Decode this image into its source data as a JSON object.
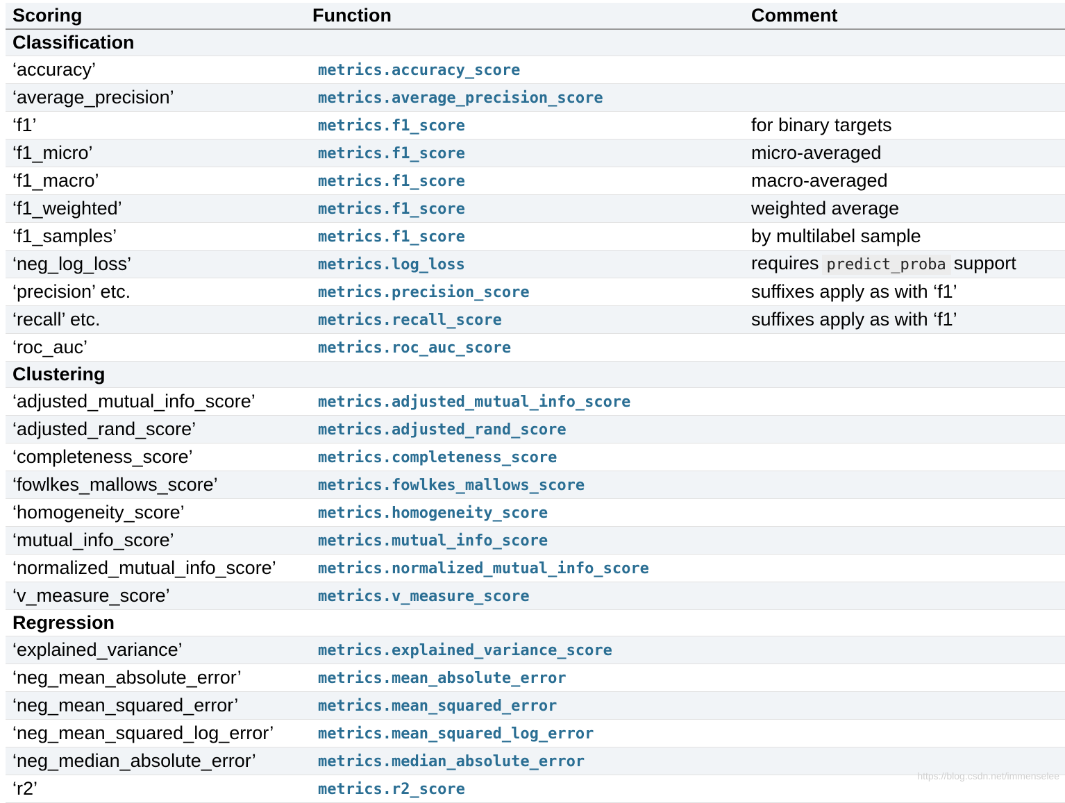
{
  "headers": {
    "scoring": "Scoring",
    "function": "Function",
    "comment": "Comment"
  },
  "sections": {
    "classification": "Classification",
    "clustering": "Clustering",
    "regression": "Regression"
  },
  "classification": [
    {
      "scoring": "‘accuracy’",
      "function": "metrics.accuracy_score",
      "comment": ""
    },
    {
      "scoring": "‘average_precision’",
      "function": "metrics.average_precision_score",
      "comment": ""
    },
    {
      "scoring": "‘f1’",
      "function": "metrics.f1_score",
      "comment": "for binary targets"
    },
    {
      "scoring": "‘f1_micro’",
      "function": "metrics.f1_score",
      "comment": "micro-averaged"
    },
    {
      "scoring": "‘f1_macro’",
      "function": "metrics.f1_score",
      "comment": "macro-averaged"
    },
    {
      "scoring": "‘f1_weighted’",
      "function": "metrics.f1_score",
      "comment": "weighted average"
    },
    {
      "scoring": "‘f1_samples’",
      "function": "metrics.f1_score",
      "comment": "by multilabel sample"
    },
    {
      "scoring": "‘neg_log_loss’",
      "function": "metrics.log_loss",
      "comment_before": "requires",
      "comment_code": "predict_proba",
      "comment_after": "support"
    },
    {
      "scoring": "‘precision’ etc.",
      "function": "metrics.precision_score",
      "comment": "suffixes apply as with ‘f1’"
    },
    {
      "scoring": "‘recall’ etc.",
      "function": "metrics.recall_score",
      "comment": "suffixes apply as with ‘f1’"
    },
    {
      "scoring": "‘roc_auc’",
      "function": "metrics.roc_auc_score",
      "comment": ""
    }
  ],
  "clustering": [
    {
      "scoring": "‘adjusted_mutual_info_score’",
      "function": "metrics.adjusted_mutual_info_score",
      "comment": ""
    },
    {
      "scoring": "‘adjusted_rand_score’",
      "function": "metrics.adjusted_rand_score",
      "comment": ""
    },
    {
      "scoring": "‘completeness_score’",
      "function": "metrics.completeness_score",
      "comment": ""
    },
    {
      "scoring": "‘fowlkes_mallows_score’",
      "function": "metrics.fowlkes_mallows_score",
      "comment": ""
    },
    {
      "scoring": "‘homogeneity_score’",
      "function": "metrics.homogeneity_score",
      "comment": ""
    },
    {
      "scoring": "‘mutual_info_score’",
      "function": "metrics.mutual_info_score",
      "comment": ""
    },
    {
      "scoring": "‘normalized_mutual_info_score’",
      "function": "metrics.normalized_mutual_info_score",
      "comment": ""
    },
    {
      "scoring": "‘v_measure_score’",
      "function": "metrics.v_measure_score",
      "comment": ""
    }
  ],
  "regression": [
    {
      "scoring": "‘explained_variance’",
      "function": "metrics.explained_variance_score",
      "comment": ""
    },
    {
      "scoring": "‘neg_mean_absolute_error’",
      "function": "metrics.mean_absolute_error",
      "comment": ""
    },
    {
      "scoring": "‘neg_mean_squared_error’",
      "function": "metrics.mean_squared_error",
      "comment": ""
    },
    {
      "scoring": "‘neg_mean_squared_log_error’",
      "function": "metrics.mean_squared_log_error",
      "comment": ""
    },
    {
      "scoring": "‘neg_median_absolute_error’",
      "function": "metrics.median_absolute_error",
      "comment": ""
    },
    {
      "scoring": "‘r2’",
      "function": "metrics.r2_score",
      "comment": ""
    }
  ],
  "watermark": "https://blog.csdn.net/immenselee",
  "colors": {
    "function_link": "#2a6e93",
    "stripe": "#f1f4f7",
    "row_border": "#e1e1e1"
  }
}
